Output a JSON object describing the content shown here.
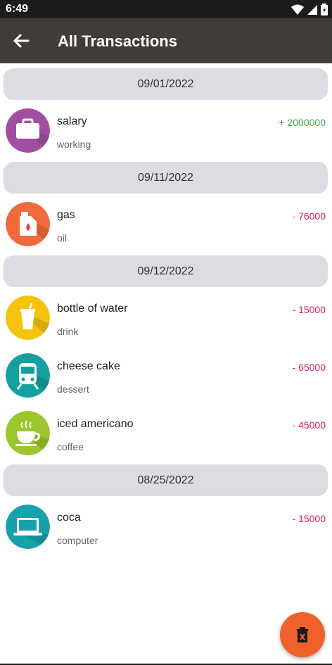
{
  "status": {
    "time": "6:49"
  },
  "app_bar": {
    "title": "All Transactions"
  },
  "groups": [
    {
      "date": "09/01/2022",
      "items": [
        {
          "title": "salary",
          "subtitle": "working",
          "amount": "+ 2000000",
          "type": "income",
          "icon": "briefcase-icon",
          "icon_color": "#a04fa0"
        }
      ]
    },
    {
      "date": "09/11/2022",
      "items": [
        {
          "title": "gas",
          "subtitle": "oil",
          "amount": "- 76000",
          "type": "expense",
          "icon": "fuel-can-icon",
          "icon_color": "#f06a3c"
        }
      ]
    },
    {
      "date": "09/12/2022",
      "items": [
        {
          "title": "bottle of water",
          "subtitle": "drink",
          "amount": "- 15000",
          "type": "expense",
          "icon": "drink-cup-icon",
          "icon_color": "#f5c20e"
        },
        {
          "title": "cheese cake",
          "subtitle": "dessert",
          "amount": "- 65000",
          "type": "expense",
          "icon": "train-icon",
          "icon_color": "#14a0a0"
        },
        {
          "title": "iced americano",
          "subtitle": "coffee",
          "amount": "- 45000",
          "type": "expense",
          "icon": "coffee-cup-icon",
          "icon_color": "#9bc62c"
        }
      ]
    },
    {
      "date": "08/25/2022",
      "items": [
        {
          "title": "coca",
          "subtitle": "computer",
          "amount": "- 15000",
          "type": "expense",
          "icon": "laptop-icon",
          "icon_color": "#17a2ab"
        }
      ]
    }
  ],
  "colors": {
    "income": "#43a047",
    "expense": "#d81b60",
    "fab": "#f0602a",
    "app_bar": "#403d39"
  },
  "fab": {
    "icon": "delete-icon"
  }
}
